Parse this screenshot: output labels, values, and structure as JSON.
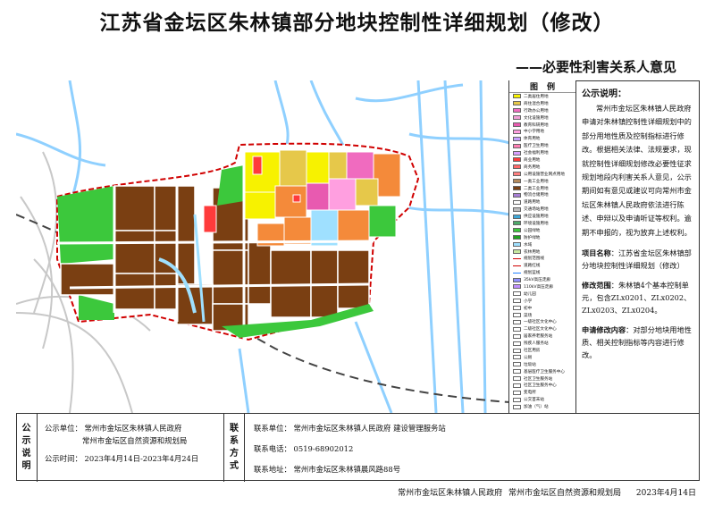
{
  "title": "江苏省金坛区朱林镇部分地块控制性详细规划（修改）",
  "subtitle": "——必要性利害关系人意见",
  "legend": {
    "title": "图例",
    "items": [
      {
        "label": "二类居住用地",
        "color": "#f7f200"
      },
      {
        "label": "商住混合用地",
        "color": "#e6c84a"
      },
      {
        "label": "行政办公用地",
        "color": "#f06bbf"
      },
      {
        "label": "文化设施用地",
        "color": "#f2a0d8"
      },
      {
        "label": "教育科研用地",
        "color": "#e85ab0"
      },
      {
        "label": "中小学用地",
        "color": "#ff9fe0"
      },
      {
        "label": "体育用地",
        "color": "#c8a0ff"
      },
      {
        "label": "医疗卫生用地",
        "color": "#ff7fb4"
      },
      {
        "label": "社会福利用地",
        "color": "#d9a0ff"
      },
      {
        "label": "商业用地",
        "color": "#ff3b3b"
      },
      {
        "label": "商务用地",
        "color": "#ff6a6a"
      },
      {
        "label": "公用设施营业网点用地",
        "color": "#ff8080"
      },
      {
        "label": "一类工业用地",
        "color": "#b58a5c"
      },
      {
        "label": "二类工业用地",
        "color": "#7a3f12"
      },
      {
        "label": "物流仓储用地",
        "color": "#a87fd6"
      },
      {
        "label": "道路用地",
        "color": "#ffffff"
      },
      {
        "label": "交通场站用地",
        "color": "#bdbdbd"
      },
      {
        "label": "供应设施用地",
        "color": "#3fa8d8"
      },
      {
        "label": "环境设施用地",
        "color": "#4da86a"
      },
      {
        "label": "公园绿地",
        "color": "#3cc83c"
      },
      {
        "label": "防护绿地",
        "color": "#1fa21f"
      },
      {
        "label": "水域",
        "color": "#9fe0ff"
      },
      {
        "label": "农林用地",
        "color": "#c8e8a0"
      },
      {
        "label": "规划范围线",
        "color": "#d00000"
      },
      {
        "label": "道路红线",
        "color": "#d00000"
      },
      {
        "label": "规划蓝线",
        "color": "#2080ff"
      },
      {
        "label": "35kV高压走廊",
        "color": "#9090ff"
      },
      {
        "label": "110kV高压走廊",
        "color": "#c090ff"
      },
      {
        "label": "幼儿园",
        "color": "#ffffff"
      },
      {
        "label": "小学",
        "color": "#ffffff"
      },
      {
        "label": "初中",
        "color": "#ffffff"
      },
      {
        "label": "菜场",
        "color": "#ffffff"
      },
      {
        "label": "一级社区文化中心",
        "color": "#ffffff"
      },
      {
        "label": "二级社区文化中心",
        "color": "#ffffff"
      },
      {
        "label": "居家养老服务站",
        "color": "#ffffff"
      },
      {
        "label": "残疾人服务站",
        "color": "#ffffff"
      },
      {
        "label": "社区用房",
        "color": "#ffffff"
      },
      {
        "label": "公厕",
        "color": "#ffffff"
      },
      {
        "label": "垃圾站",
        "color": "#ffffff"
      },
      {
        "label": "基层医疗卫生服务中心",
        "color": "#ffffff"
      },
      {
        "label": "社区卫生服务站",
        "color": "#ffffff"
      },
      {
        "label": "社区卫生服务中心",
        "color": "#ffffff"
      },
      {
        "label": "变电所",
        "color": "#ffffff"
      },
      {
        "label": "公交首末站",
        "color": "#ffffff"
      },
      {
        "label": "加油（气）站",
        "color": "#ffffff"
      },
      {
        "label": "消防站",
        "color": "#ffffff"
      },
      {
        "label": "社会公共停车场",
        "color": "#ffffff"
      },
      {
        "label": "电信局",
        "color": "#ffffff"
      },
      {
        "label": "污水泵站",
        "color": "#ffffff"
      },
      {
        "label": "邮政支局",
        "color": "#ffffff"
      },
      {
        "label": "雨水泵站",
        "color": "#ffffff"
      }
    ]
  },
  "notice": {
    "heading": "公示说明：",
    "body": "常州市金坛区朱林镇人民政府申请对朱林镇控制性详细规划中的部分用地性质及控制指标进行修改。根据相关法律、法规要求，现就控制性详细规划修改必要性征求规划地段内利害关系人意见，公示期间如有意见或建议可向常州市金坛区朱林镇人民政府依法进行陈述、申辩以及申请听证等权利。逾期不申报的，视为放弃上述权利。",
    "project_label": "项目名称",
    "project_value": "：江苏省金坛区朱林镇部分地块控制性详细规划（修改）",
    "scope_label": "修改范围",
    "scope_value": "：朱林镇4个基本控制单元，包含ZLx0201、ZLx0202、ZLx0203、ZLx0204。",
    "content_label": "申请修改内容",
    "content_value": "：对部分地块用地性质、相关控制指标等内容进行修改。"
  },
  "bottom": {
    "left_label": "公示说明",
    "unit_label": "公示单位：",
    "unit_1": "常州市金坛区朱林镇人民政府",
    "unit_2": "常州市金坛区自然资源和规划局",
    "time_label": "公示时间：",
    "time_value": "2023年4月14日-2023年4月24日",
    "contact_label": "联系方式",
    "contact_unit_label": "联系单位：",
    "contact_unit_value": "常州市金坛区朱林镇人民政府   建设管理服务站",
    "phone_label": "联系电话：",
    "phone_value": "0519-68902012",
    "address_label": "联系地址：",
    "address_value": "常州市金坛区朱林镇晨风路88号"
  },
  "footer": {
    "org_1": "常州市金坛区朱林镇人民政府",
    "org_2": "常州市金坛区自然资源和规划局",
    "date": "2023年4月14日"
  }
}
